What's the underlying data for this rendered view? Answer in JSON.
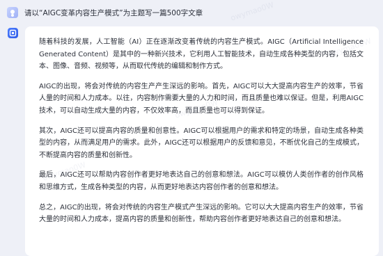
{
  "user_message": {
    "text": "请以“AIGC变革内容生产模式”为主题写一篇500字文章"
  },
  "answer": {
    "paragraphs": [
      "随着科技的发展，人工智能（AI）正在逐渐改变着传统的内容生产模式。AIGC（Artificial Intelligence Generated Content）是其中的一种新兴技术，它利用人工智能技术，自动生成各种类型的内容，包括文本、图像、音频、视频等，从而取代传统的编辑和制作方式。",
      "AIGC的出现，将会对传统的内容生产产生深远的影响。首先，AIGC可以大大提高内容生产的效率，节省人量的时间和人力成本。以往，内容制作需要大量的人力和时间，而且质量也难以保证。但是，利用AIGC技术，可以自动生成大量的内容，不仅效率高，而且质量也可以得到保证。",
      "其次，AIGC还可以提高内容的质量和创意性。AIGC可以根据用户的需求和特定的场景，自动生成各种类型的内容，从而满足用户的需求。此外，AIGC还可以根据用户的反馈和意见，不断优化自己的生成模式，不断提高内容的质量和创新性。",
      "最后，AIGC还可以帮助内容创作者更好地表达自己的创意和想法。AIGC可以模仿人类创作者的创作风格和思维方式，生成各种类型的内容，从而更好地表达内容创作者的创意和想法。",
      "总之，AIGC的出现，将会对传统的内容生产模式产生深远的影响。它可以大大提高内容生产的效率，节省大量的时间和人力成本，提高内容的质量和创新性，帮助内容创作者更好地表达自己的创意和想法。"
    ]
  },
  "watermark": {
    "text": "owymao0W"
  },
  "icons": {
    "user_avatar": "user-avatar-icon",
    "assistant": "assistant-logo-icon"
  },
  "colors": {
    "page_background": "#eef0f7",
    "card_background": "#ffffff",
    "assistant_icon": "#3b6cf5",
    "text": "#2d313b"
  }
}
